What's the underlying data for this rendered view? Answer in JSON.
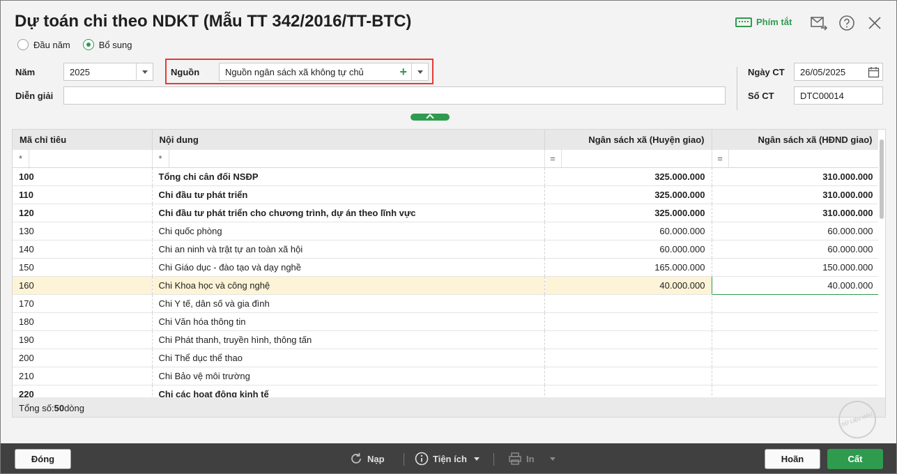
{
  "window": {
    "title": "Dự toán chi theo NDKT (Mẫu TT 342/2016/TT-BTC)"
  },
  "toolbar_top": {
    "shortcut_label": "Phím tắt"
  },
  "options": {
    "radio_dau_nam": "Đầu năm",
    "radio_bo_sung": "Bổ sung",
    "selected": "Bổ sung"
  },
  "form": {
    "nam_label": "Năm",
    "nam_value": "2025",
    "nguon_label": "Nguồn",
    "nguon_value": "Nguồn ngân sách  xã không tự chủ",
    "dien_giai_label": "Diễn giải",
    "dien_giai_value": "",
    "ngay_ct_label": "Ngày CT",
    "ngay_ct_value": "26/05/2025",
    "so_ct_label": "Số CT",
    "so_ct_value": "DTC00014"
  },
  "grid": {
    "columns": [
      "Mã chỉ tiêu",
      "Nội dung",
      "Ngân sách xã (Huyện giao)",
      "Ngân sách xã (HĐND giao)"
    ],
    "filter_symbols": [
      "*",
      "*",
      "=",
      "="
    ],
    "rows": [
      {
        "code": "100",
        "content": "Tổng chi cân đối NSĐP",
        "huyen": "325.000.000",
        "hdnd": "310.000.000",
        "bold": true
      },
      {
        "code": "110",
        "content": "Chi đầu tư phát triển",
        "huyen": "325.000.000",
        "hdnd": "310.000.000",
        "bold": true
      },
      {
        "code": "120",
        "content": "Chi đầu tư phát triển cho chương trình, dự án theo lĩnh vực",
        "huyen": "325.000.000",
        "hdnd": "310.000.000",
        "bold": true
      },
      {
        "code": "130",
        "content": "Chi quốc phòng",
        "huyen": "60.000.000",
        "hdnd": "60.000.000",
        "bold": false
      },
      {
        "code": "140",
        "content": "Chi an ninh và trật tự an toàn xã hội",
        "huyen": "60.000.000",
        "hdnd": "60.000.000",
        "bold": false
      },
      {
        "code": "150",
        "content": "Chi Giáo dục - đào tạo và dạy nghề",
        "huyen": "165.000.000",
        "hdnd": "150.000.000",
        "bold": false
      },
      {
        "code": "160",
        "content": "Chi Khoa học và công nghệ",
        "huyen": "40.000.000",
        "hdnd": "40.000.000",
        "bold": false,
        "selected": true
      },
      {
        "code": "170",
        "content": "Chi Y tế, dân số và gia đình",
        "huyen": "",
        "hdnd": "",
        "bold": false
      },
      {
        "code": "180",
        "content": "Chi Văn hóa thông tin",
        "huyen": "",
        "hdnd": "",
        "bold": false
      },
      {
        "code": "190",
        "content": "Chi Phát thanh, truyền hình, thông tấn",
        "huyen": "",
        "hdnd": "",
        "bold": false
      },
      {
        "code": "200",
        "content": "Chi Thể dục thể thao",
        "huyen": "",
        "hdnd": "",
        "bold": false
      },
      {
        "code": "210",
        "content": "Chi Bảo vệ môi trường",
        "huyen": "",
        "hdnd": "",
        "bold": false
      },
      {
        "code": "220",
        "content": "Chi các hoạt động kinh tế",
        "huyen": "",
        "hdnd": "",
        "bold": true
      }
    ],
    "footer_prefix": "Tổng số: ",
    "footer_count": "50",
    "footer_suffix": " dòng"
  },
  "watermark": "DỮ LIỆU MẪU",
  "bottom": {
    "close_label": "Đóng",
    "reload_label": "Nạp",
    "utility_label": "Tiện ích",
    "print_label": "In",
    "cancel_label": "Hoãn",
    "save_label": "Cất"
  },
  "colors": {
    "accent": "#2e9b4f",
    "highlight": "#e53935",
    "selected_row": "#fdf3d7"
  }
}
